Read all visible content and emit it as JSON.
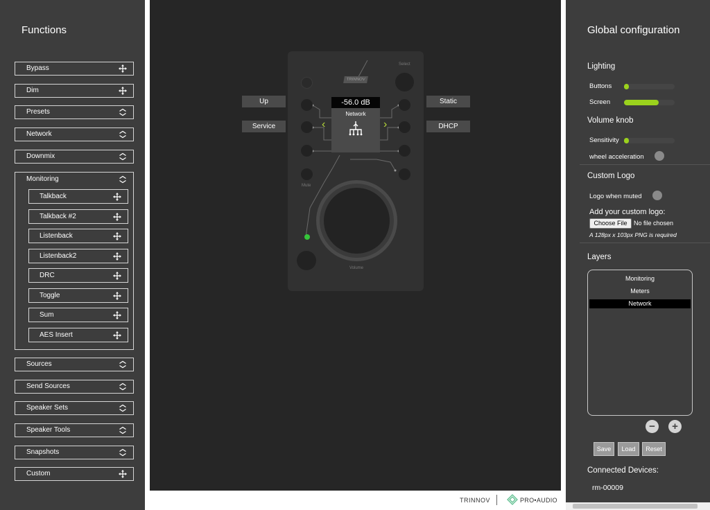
{
  "left_panel": {
    "title": "Functions",
    "items": [
      {
        "label": "Bypass",
        "icon": "move-icon"
      },
      {
        "label": "Dim",
        "icon": "move-icon"
      },
      {
        "label": "Presets",
        "icon": "expand-icon"
      },
      {
        "label": "Network",
        "icon": "expand-icon"
      },
      {
        "label": "Downmix",
        "icon": "expand-icon"
      }
    ],
    "monitoring": {
      "label": "Monitoring",
      "icon": "collapse-icon",
      "children": [
        "Talkback",
        "Talkback #2",
        "Listenback",
        "Listenback2",
        "DRC",
        "Toggle",
        "Sum",
        "AES Insert"
      ]
    },
    "items_after": [
      {
        "label": "Sources",
        "icon": "expand-icon"
      },
      {
        "label": "Send Sources",
        "icon": "expand-icon"
      },
      {
        "label": "Speaker Sets",
        "icon": "expand-icon"
      },
      {
        "label": "Speaker Tools",
        "icon": "expand-icon"
      },
      {
        "label": "Snapshots",
        "icon": "expand-icon"
      },
      {
        "label": "Custom",
        "icon": "move-icon"
      }
    ]
  },
  "device": {
    "left_labels": [
      "Up",
      "Service"
    ],
    "right_labels": [
      "Static",
      "DHCP"
    ],
    "screen_value": "-56.0 dB",
    "screen_mode": "Network",
    "select_label": "Select",
    "mute_label": "Mute",
    "volume_label": "Volume",
    "logo_text": "TRINNOV"
  },
  "footer": {
    "brand": "TRINNOV",
    "product": "PRO•AUDIO"
  },
  "right_panel": {
    "title": "Global configuration",
    "lighting": {
      "heading": "Lighting",
      "buttons_label": "Buttons",
      "buttons_level": 0.1,
      "screen_label": "Screen",
      "screen_level": 0.68
    },
    "volume_knob": {
      "heading": "Volume knob",
      "sensitivity_label": "Sensitivity",
      "sensitivity_level": 0.1,
      "wheel_label": "wheel acceleration"
    },
    "custom_logo": {
      "heading": "Custom Logo",
      "muted_label": "Logo when muted",
      "add_label": "Add your custom logo:",
      "choose_label": "Choose File",
      "no_file": "No file chosen",
      "requirement": "A 128px x 103px PNG is required"
    },
    "layers": {
      "heading": "Layers",
      "items": [
        "Monitoring",
        "Meters",
        "Network"
      ],
      "selected": "Network",
      "remove": "−",
      "add": "+"
    },
    "actions": {
      "save": "Save",
      "load": "Load",
      "reset": "Reset"
    },
    "connected": {
      "heading": "Connected Devices:",
      "device": "rm-00009"
    },
    "colors": {
      "accent": "#9bd21d",
      "panel": "#3d3d3d",
      "stage": "#262626"
    }
  }
}
